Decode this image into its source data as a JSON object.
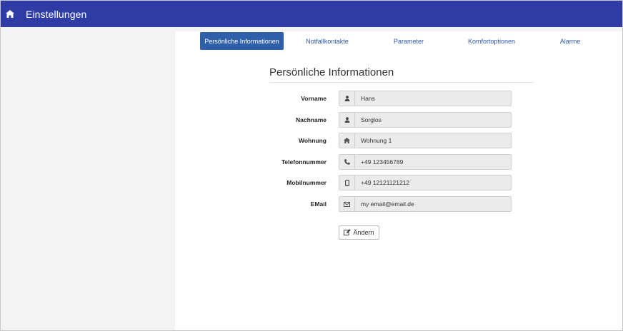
{
  "header": {
    "title": "Einstellungen",
    "home_icon": "home-icon",
    "background_color": "#2f3ca6"
  },
  "tabs": [
    {
      "label": "Persönliche Informationen",
      "active": true
    },
    {
      "label": "Notfallkontakte",
      "active": false
    },
    {
      "label": "Parameter",
      "active": false
    },
    {
      "label": "Komfortoptionen",
      "active": false
    },
    {
      "label": "Alarme",
      "active": false
    }
  ],
  "section": {
    "title": "Persönliche Informationen"
  },
  "form": {
    "fields": [
      {
        "label": "Vorname",
        "icon": "user-icon",
        "value": "Hans"
      },
      {
        "label": "Nachname",
        "icon": "user-icon",
        "value": "Sorglos"
      },
      {
        "label": "Wohnung",
        "icon": "home-icon",
        "value": "Wohnung 1"
      },
      {
        "label": "Telefonnummer",
        "icon": "phone-icon",
        "value": "+49 123456789"
      },
      {
        "label": "Mobilnummer",
        "icon": "mobile-icon",
        "value": "+49 12121121212"
      },
      {
        "label": "EMail",
        "icon": "envelope-icon",
        "value": "my email@email.de"
      }
    ],
    "edit_button": {
      "label": "Ändern",
      "icon": "edit-icon"
    }
  },
  "colors": {
    "accent": "#2f5fa8",
    "tab_link": "#2f58b2",
    "sidebar": "#f3f3f3"
  }
}
